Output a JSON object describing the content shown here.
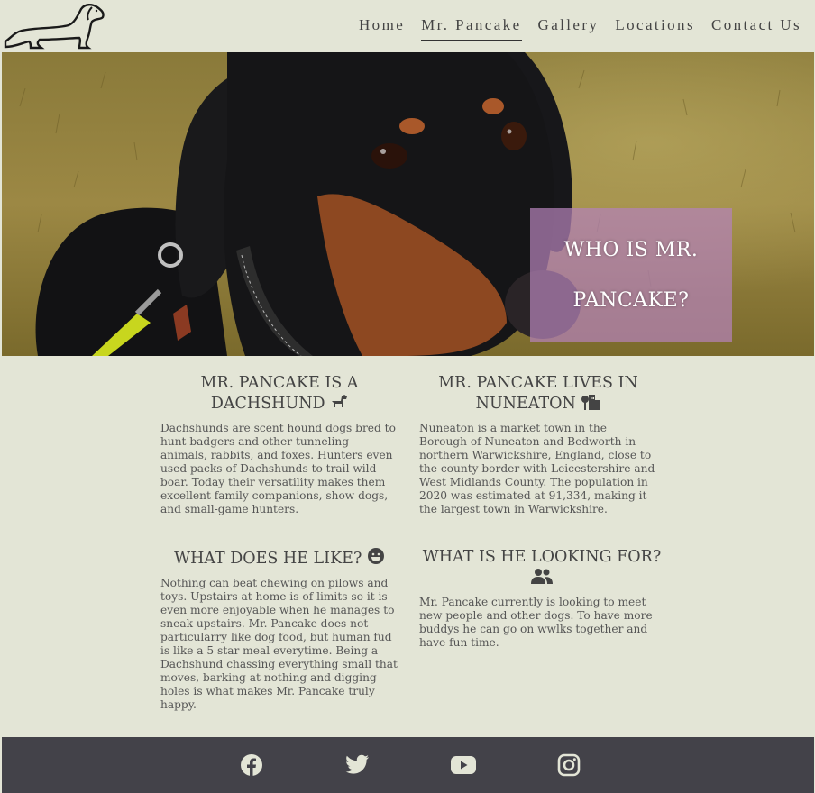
{
  "nav": {
    "items": [
      {
        "label": "Home"
      },
      {
        "label": "Mr. Pancake"
      },
      {
        "label": "Gallery"
      },
      {
        "label": "Locations"
      },
      {
        "label": "Contact Us"
      }
    ],
    "active": "Mr. Pancake"
  },
  "hero": {
    "line1": "WHO IS MR.",
    "line2": "PANCAKE?"
  },
  "sections": [
    {
      "title": "MR. PANCAKE IS A DACHSHUND",
      "icon": "dog-icon",
      "text": "Dachshunds are scent hound dogs bred to hunt badgers and other tunneling animals, rabbits, and foxes. Hunters even used packs of Dachshunds to trail wild boar. Today their versatility makes them excellent family companions, show dogs, and small-game hunters."
    },
    {
      "title": "MR. PANCAKE LIVES IN NUNEATON",
      "icon": "city-icon",
      "text": "Nuneaton is a market town in the Borough of Nuneaton and Bedworth in northern Warwickshire, England, close to the county border with Leicestershire and West Midlands County. The population in 2020 was estimated at 91,334, making it the largest town in Warwickshire."
    },
    {
      "title": "WHAT DOES HE LIKE?",
      "icon": "grin-icon",
      "text": "Nothing can beat chewing on pilows and toys. Upstairs at home is of limits so it is even more enjoyable when he manages to sneak upstairs. Mr. Pancake does not particularry like dog food, but human fud is like a 5 star meal everytime. Being a Dachshund chassing everything small that moves, barking at nothing and digging holes is what makes Mr. Pancake truly happy."
    },
    {
      "title": "WHAT IS HE LOOKING FOR?",
      "icon": "users-icon",
      "text": "Mr. Pancake currently is looking to meet new people and other dogs. To have more buddys he can go on wwlks together and have fun time."
    }
  ],
  "footer": {
    "social": [
      "facebook-icon",
      "twitter-icon",
      "youtube-icon",
      "instagram-icon"
    ]
  },
  "colors": {
    "background": "#e3e5d6",
    "footer": "#434249",
    "hero_box": "#b482b9",
    "text": "#4a4a4a"
  }
}
